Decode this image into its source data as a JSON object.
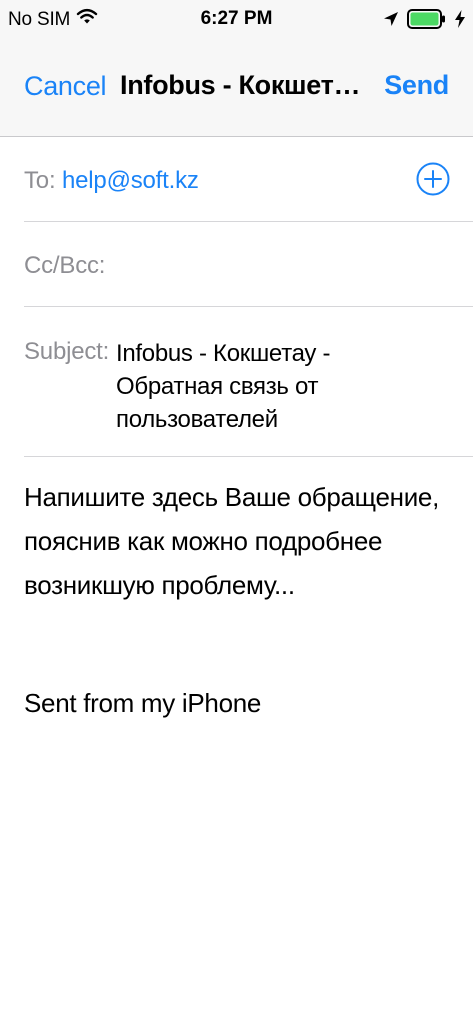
{
  "status_bar": {
    "carrier": "No SIM",
    "time": "6:27 PM",
    "wifi_icon": "wifi-icon",
    "location_icon": "location-arrow-icon",
    "battery_icon": "battery-icon",
    "charging_icon": "charging-bolt-icon",
    "battery_level": 1.0
  },
  "nav": {
    "cancel_label": "Cancel",
    "title": "Infobus - Кокшетау...",
    "send_label": "Send"
  },
  "fields": {
    "to_label": "To:",
    "to_value": "help@soft.kz",
    "cc_bcc_label": "Cc/Bcc:",
    "subject_label": "Subject:",
    "subject_value": "Infobus - Кокшетау - Обратная связь от пользователей"
  },
  "body": {
    "message": "Напишите здесь Ваше обращение, пояснив как можно подробнее возникшую проблему...",
    "signature": "Sent from my iPhone"
  },
  "colors": {
    "accent": "#1a83f7",
    "label_gray": "#8e8e93",
    "battery_green": "#4cd964"
  }
}
